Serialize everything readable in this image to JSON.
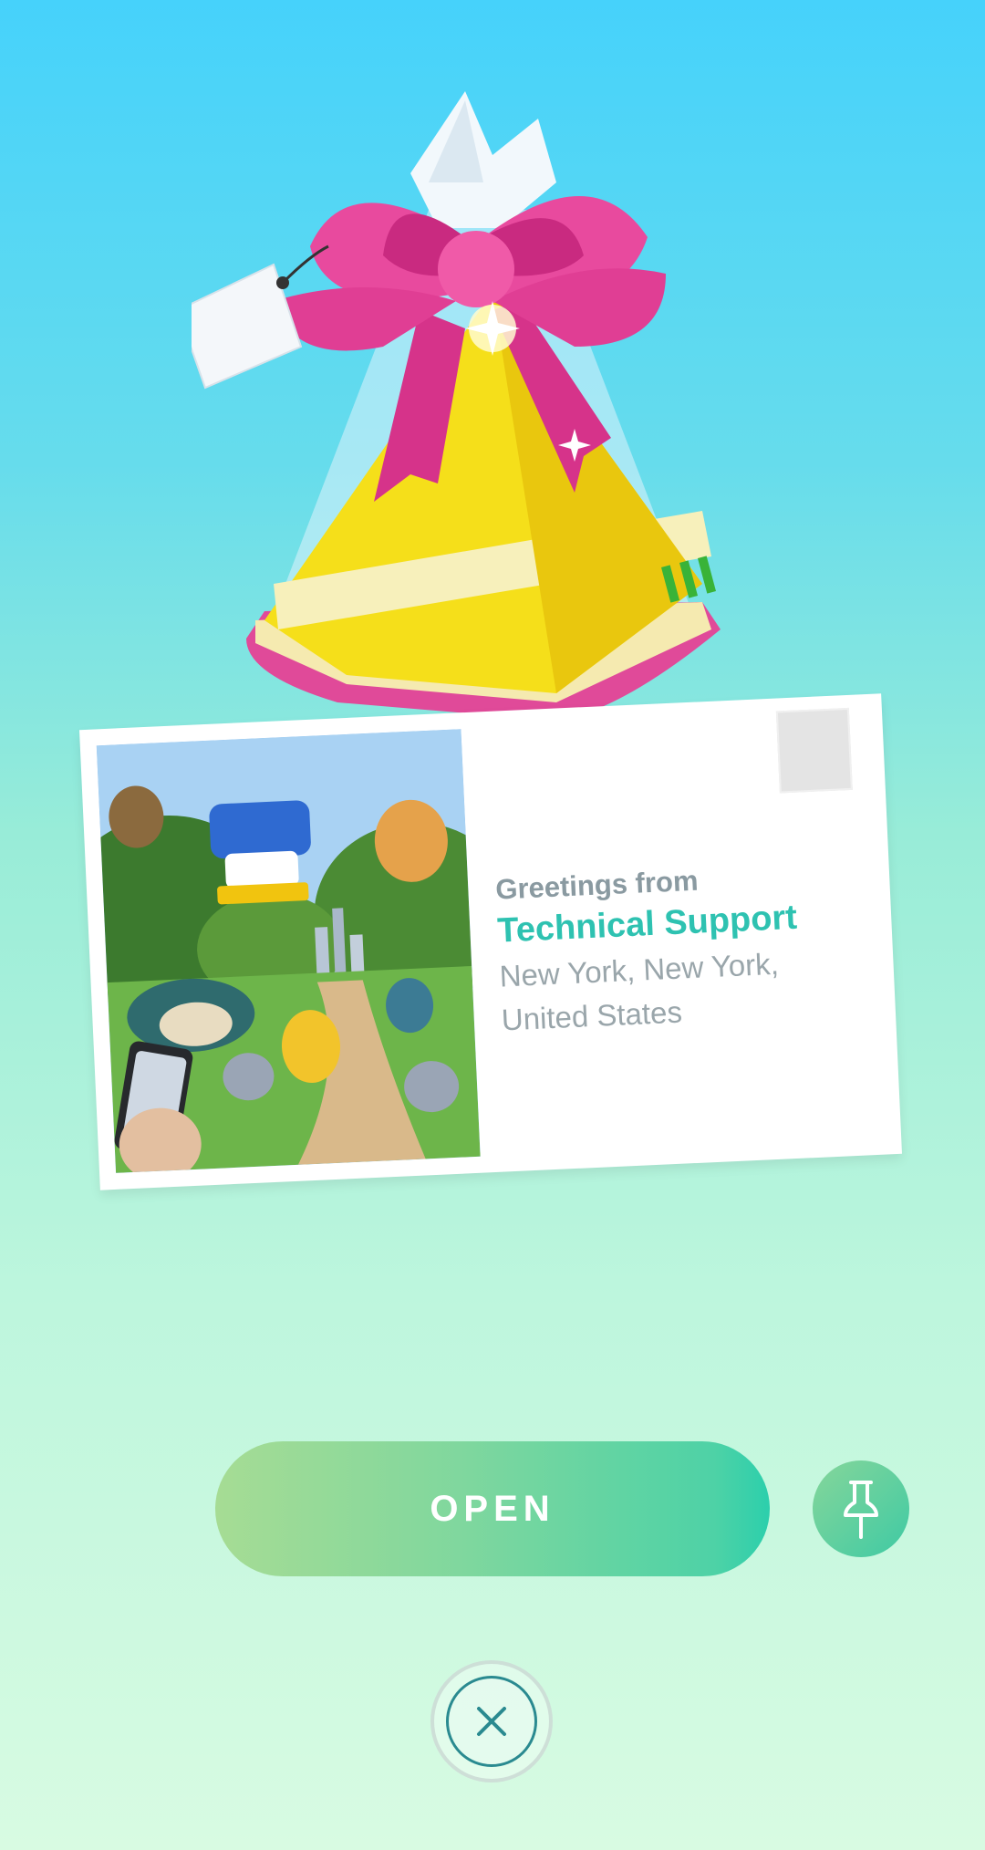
{
  "postcard": {
    "greeting": "Greetings from",
    "sender": "Technical Support",
    "location_line1": "New York, New York,",
    "location_line2": "United States"
  },
  "actions": {
    "open_label": "OPEN"
  },
  "icons": {
    "gift": "gift-icon",
    "pin": "pin-icon",
    "close": "close-icon"
  },
  "colors": {
    "sender": "#2ec2b1",
    "open_gradient_start": "#a6dc94",
    "open_gradient_end": "#2ccfac",
    "bow": "#e0409a",
    "gift_body": "#f5e020"
  }
}
